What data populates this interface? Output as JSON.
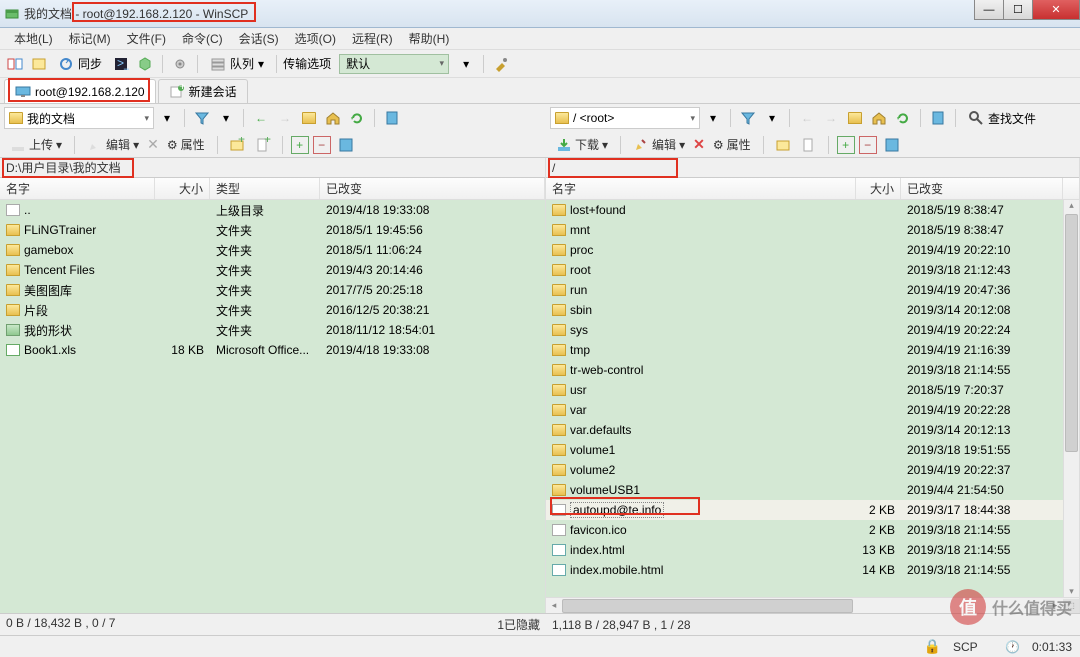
{
  "window": {
    "title": "我的文档 - root@192.168.2.120 - WinSCP"
  },
  "menu": {
    "local": "本地(L)",
    "mark": "标记(M)",
    "file": "文件(F)",
    "command": "命令(C)",
    "session": "会话(S)",
    "options": "选项(O)",
    "remote": "远程(R)",
    "help": "帮助(H)"
  },
  "toolbar": {
    "sync": "同步",
    "queue": "队列",
    "transfer_label": "传输选项",
    "transfer_value": "默认"
  },
  "tabs": {
    "session": "root@192.168.2.120",
    "new_session": "新建会话"
  },
  "left": {
    "loc_label": "我的文档",
    "upload": "上传",
    "edit": "编辑",
    "props": "属性",
    "path": "D:\\用户目录\\我的文档",
    "cols": {
      "name": "名字",
      "size": "大小",
      "type": "类型",
      "mod": "已改变"
    },
    "rows": [
      {
        "icon": "up",
        "name": "..",
        "size": "",
        "type": "上级目录",
        "mod": "2019/4/18  19:33:08"
      },
      {
        "icon": "folder",
        "name": "FLiNGTrainer",
        "size": "",
        "type": "文件夹",
        "mod": "2018/5/1  19:45:56"
      },
      {
        "icon": "folder",
        "name": "gamebox",
        "size": "",
        "type": "文件夹",
        "mod": "2018/5/1  11:06:24"
      },
      {
        "icon": "folder",
        "name": "Tencent Files",
        "size": "",
        "type": "文件夹",
        "mod": "2019/4/3  20:14:46"
      },
      {
        "icon": "folder",
        "name": "美图图库",
        "size": "",
        "type": "文件夹",
        "mod": "2017/7/5  20:25:18"
      },
      {
        "icon": "folder",
        "name": "片段",
        "size": "",
        "type": "文件夹",
        "mod": "2016/12/5  20:38:21"
      },
      {
        "icon": "folder-sp",
        "name": "我的形状",
        "size": "",
        "type": "文件夹",
        "mod": "2018/11/12  18:54:01"
      },
      {
        "icon": "xls",
        "name": "Book1.xls",
        "size": "18 KB",
        "type": "Microsoft Office...",
        "mod": "2019/4/18  19:33:08"
      }
    ],
    "status": "0 B / 18,432 B , 0 / 7",
    "hidden": "1已隐藏"
  },
  "right": {
    "loc_label": "/ <root>",
    "download": "下载",
    "edit": "编辑",
    "props": "属性",
    "find": "查找文件",
    "path": "/",
    "cols": {
      "name": "名字",
      "size": "大小",
      "mod": "已改变"
    },
    "rows": [
      {
        "icon": "folder",
        "name": "lost+found",
        "size": "",
        "mod": "2018/5/19 8:38:47"
      },
      {
        "icon": "folder",
        "name": "mnt",
        "size": "",
        "mod": "2018/5/19 8:38:47"
      },
      {
        "icon": "folder",
        "name": "proc",
        "size": "",
        "mod": "2019/4/19 20:22:10"
      },
      {
        "icon": "folder",
        "name": "root",
        "size": "",
        "mod": "2019/3/18 21:12:43"
      },
      {
        "icon": "folder",
        "name": "run",
        "size": "",
        "mod": "2019/4/19 20:47:36"
      },
      {
        "icon": "folder",
        "name": "sbin",
        "size": "",
        "mod": "2019/3/14 20:12:08"
      },
      {
        "icon": "folder",
        "name": "sys",
        "size": "",
        "mod": "2019/4/19 20:22:24"
      },
      {
        "icon": "folder",
        "name": "tmp",
        "size": "",
        "mod": "2019/4/19 21:16:39"
      },
      {
        "icon": "folder",
        "name": "tr-web-control",
        "size": "",
        "mod": "2019/3/18 21:14:55"
      },
      {
        "icon": "folder",
        "name": "usr",
        "size": "",
        "mod": "2018/5/19 7:20:37"
      },
      {
        "icon": "folder",
        "name": "var",
        "size": "",
        "mod": "2019/4/19 20:22:28"
      },
      {
        "icon": "folder",
        "name": "var.defaults",
        "size": "",
        "mod": "2019/3/14 20:12:13"
      },
      {
        "icon": "folder",
        "name": "volume1",
        "size": "",
        "mod": "2019/3/18 19:51:55"
      },
      {
        "icon": "folder",
        "name": "volume2",
        "size": "",
        "mod": "2019/4/19 20:22:37"
      },
      {
        "icon": "folder",
        "name": "volumeUSB1",
        "size": "",
        "mod": "2019/4/4 21:54:50"
      },
      {
        "icon": "file",
        "name": "autoupd@te.info",
        "size": "2 KB",
        "mod": "2019/3/17 18:44:38",
        "selected": true
      },
      {
        "icon": "file",
        "name": "favicon.ico",
        "size": "2 KB",
        "mod": "2019/3/18 21:14:55"
      },
      {
        "icon": "html",
        "name": "index.html",
        "size": "13 KB",
        "mod": "2019/3/18 21:14:55"
      },
      {
        "icon": "html",
        "name": "index.mobile.html",
        "size": "14 KB",
        "mod": "2019/3/18 21:14:55"
      }
    ],
    "status": "1,118 B / 28,947 B , 1 / 28"
  },
  "bottom": {
    "proto": "SCP",
    "time": "0:01:33"
  },
  "watermark": {
    "logo": "值",
    "text": "什么值得买"
  }
}
